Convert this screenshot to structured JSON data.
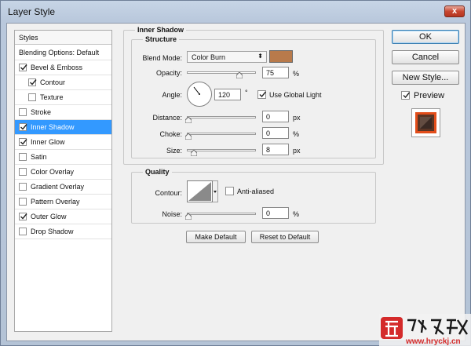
{
  "window": {
    "title": "Layer Style",
    "close_label": "x"
  },
  "styles_list": {
    "header": "Styles",
    "items": [
      {
        "label": "Blending Options: Default",
        "has_checkbox": false,
        "checked": false,
        "indent": 0,
        "selected": false
      },
      {
        "label": "Bevel & Emboss",
        "has_checkbox": true,
        "checked": true,
        "indent": 0,
        "selected": false
      },
      {
        "label": "Contour",
        "has_checkbox": true,
        "checked": true,
        "indent": 1,
        "selected": false
      },
      {
        "label": "Texture",
        "has_checkbox": true,
        "checked": false,
        "indent": 1,
        "selected": false
      },
      {
        "label": "Stroke",
        "has_checkbox": true,
        "checked": false,
        "indent": 0,
        "selected": false
      },
      {
        "label": "Inner Shadow",
        "has_checkbox": true,
        "checked": true,
        "indent": 0,
        "selected": true
      },
      {
        "label": "Inner Glow",
        "has_checkbox": true,
        "checked": true,
        "indent": 0,
        "selected": false
      },
      {
        "label": "Satin",
        "has_checkbox": true,
        "checked": false,
        "indent": 0,
        "selected": false
      },
      {
        "label": "Color Overlay",
        "has_checkbox": true,
        "checked": false,
        "indent": 0,
        "selected": false
      },
      {
        "label": "Gradient Overlay",
        "has_checkbox": true,
        "checked": false,
        "indent": 0,
        "selected": false
      },
      {
        "label": "Pattern Overlay",
        "has_checkbox": true,
        "checked": false,
        "indent": 0,
        "selected": false
      },
      {
        "label": "Outer Glow",
        "has_checkbox": true,
        "checked": true,
        "indent": 0,
        "selected": false
      },
      {
        "label": "Drop Shadow",
        "has_checkbox": true,
        "checked": false,
        "indent": 0,
        "selected": false
      }
    ]
  },
  "inner_shadow": {
    "section_title": "Inner Shadow",
    "structure_title": "Structure",
    "blend_mode_label": "Blend Mode:",
    "blend_mode_value": "Color Burn",
    "blend_color": "#b87a4b",
    "opacity_label": "Opacity:",
    "opacity_value": "75",
    "opacity_unit": "%",
    "angle_label": "Angle:",
    "angle_value": "120",
    "angle_unit": "°",
    "use_global_light_label": "Use Global Light",
    "use_global_light_checked": true,
    "distance_label": "Distance:",
    "distance_value": "0",
    "distance_unit": "px",
    "choke_label": "Choke:",
    "choke_value": "0",
    "choke_unit": "%",
    "size_label": "Size:",
    "size_value": "8",
    "size_unit": "px",
    "quality_title": "Quality",
    "contour_label": "Contour:",
    "anti_aliased_label": "Anti-aliased",
    "anti_aliased_checked": false,
    "noise_label": "Noise:",
    "noise_value": "0",
    "noise_unit": "%",
    "make_default_label": "Make Default",
    "reset_default_label": "Reset to Default"
  },
  "actions": {
    "ok_label": "OK",
    "cancel_label": "Cancel",
    "new_style_label": "New Style...",
    "preview_label": "Preview",
    "preview_checked": true
  },
  "watermark": {
    "site": "www.hryckj.cn",
    "brand_icon": "brand-logo"
  },
  "colors": {
    "selected": "#3399ff",
    "swatch": "#b87a4b"
  }
}
